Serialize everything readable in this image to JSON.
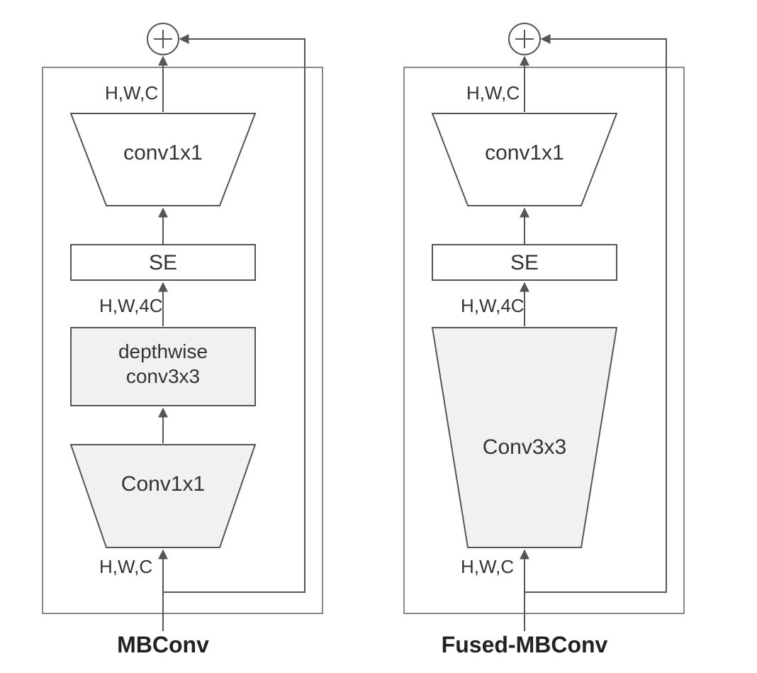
{
  "left": {
    "title": "MBConv",
    "top_dim": "H,W,C",
    "conv1x1_top": "conv1x1",
    "se": "SE",
    "mid_dim": "H,W,4C",
    "depthwise": "depthwise\nconv3x3",
    "conv1x1_bottom": "Conv1x1",
    "bottom_dim": "H,W,C"
  },
  "right": {
    "title": "Fused-MBConv",
    "top_dim": "H,W,C",
    "conv1x1_top": "conv1x1",
    "se": "SE",
    "mid_dim": "H,W,4C",
    "conv3x3": "Conv3x3",
    "bottom_dim": "H,W,C"
  }
}
